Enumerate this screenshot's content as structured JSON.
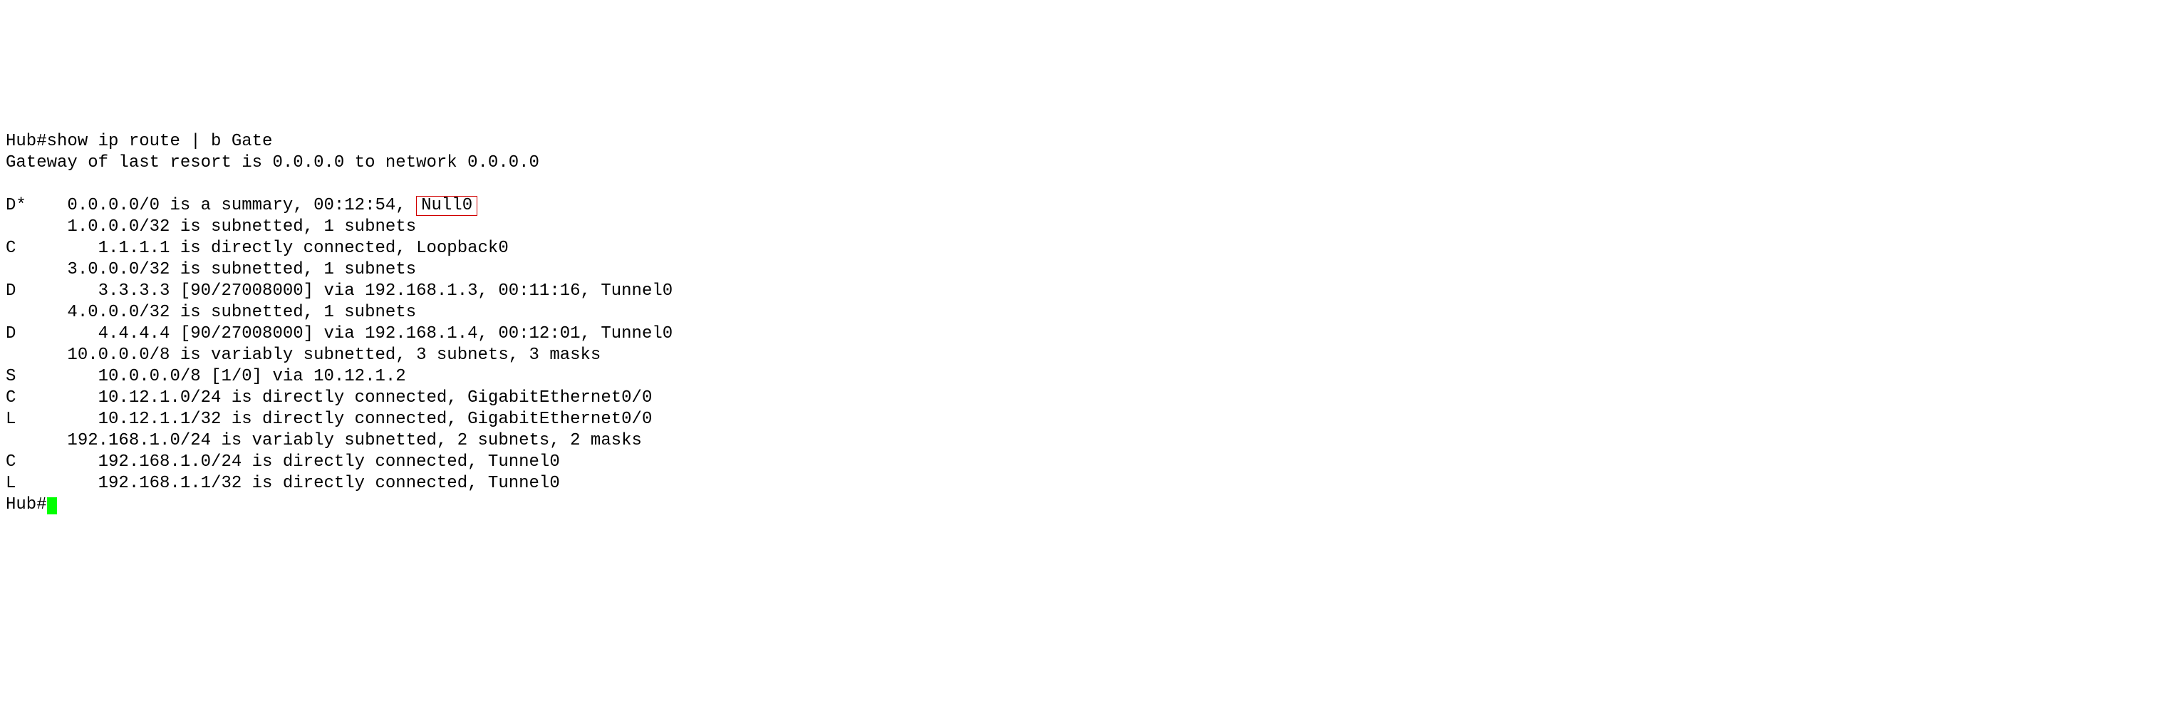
{
  "term": {
    "prompt1": "Hub#",
    "cmd1": "show ip route | b Gate",
    "gateway": "Gateway of last resort is 0.0.0.0 to network 0.0.0.0",
    "blank": "",
    "r0a": "D*    0.0.0.0/0 is a summary, 00:12:54, ",
    "r0b_hl": "Null0",
    "r1": "      1.0.0.0/32 is subnetted, 1 subnets",
    "r2": "C        1.1.1.1 is directly connected, Loopback0",
    "r3": "      3.0.0.0/32 is subnetted, 1 subnets",
    "r4": "D        3.3.3.3 [90/27008000] via 192.168.1.3, 00:11:16, Tunnel0",
    "r5": "      4.0.0.0/32 is subnetted, 1 subnets",
    "r6": "D        4.4.4.4 [90/27008000] via 192.168.1.4, 00:12:01, Tunnel0",
    "r7": "      10.0.0.0/8 is variably subnetted, 3 subnets, 3 masks",
    "r8": "S        10.0.0.0/8 [1/0] via 10.12.1.2",
    "r9": "C        10.12.1.0/24 is directly connected, GigabitEthernet0/0",
    "r10": "L        10.12.1.1/32 is directly connected, GigabitEthernet0/0",
    "r11": "      192.168.1.0/24 is variably subnetted, 2 subnets, 2 masks",
    "r12": "C        192.168.1.0/24 is directly connected, Tunnel0",
    "r13": "L        192.168.1.1/32 is directly connected, Tunnel0",
    "prompt2": "Hub#"
  }
}
